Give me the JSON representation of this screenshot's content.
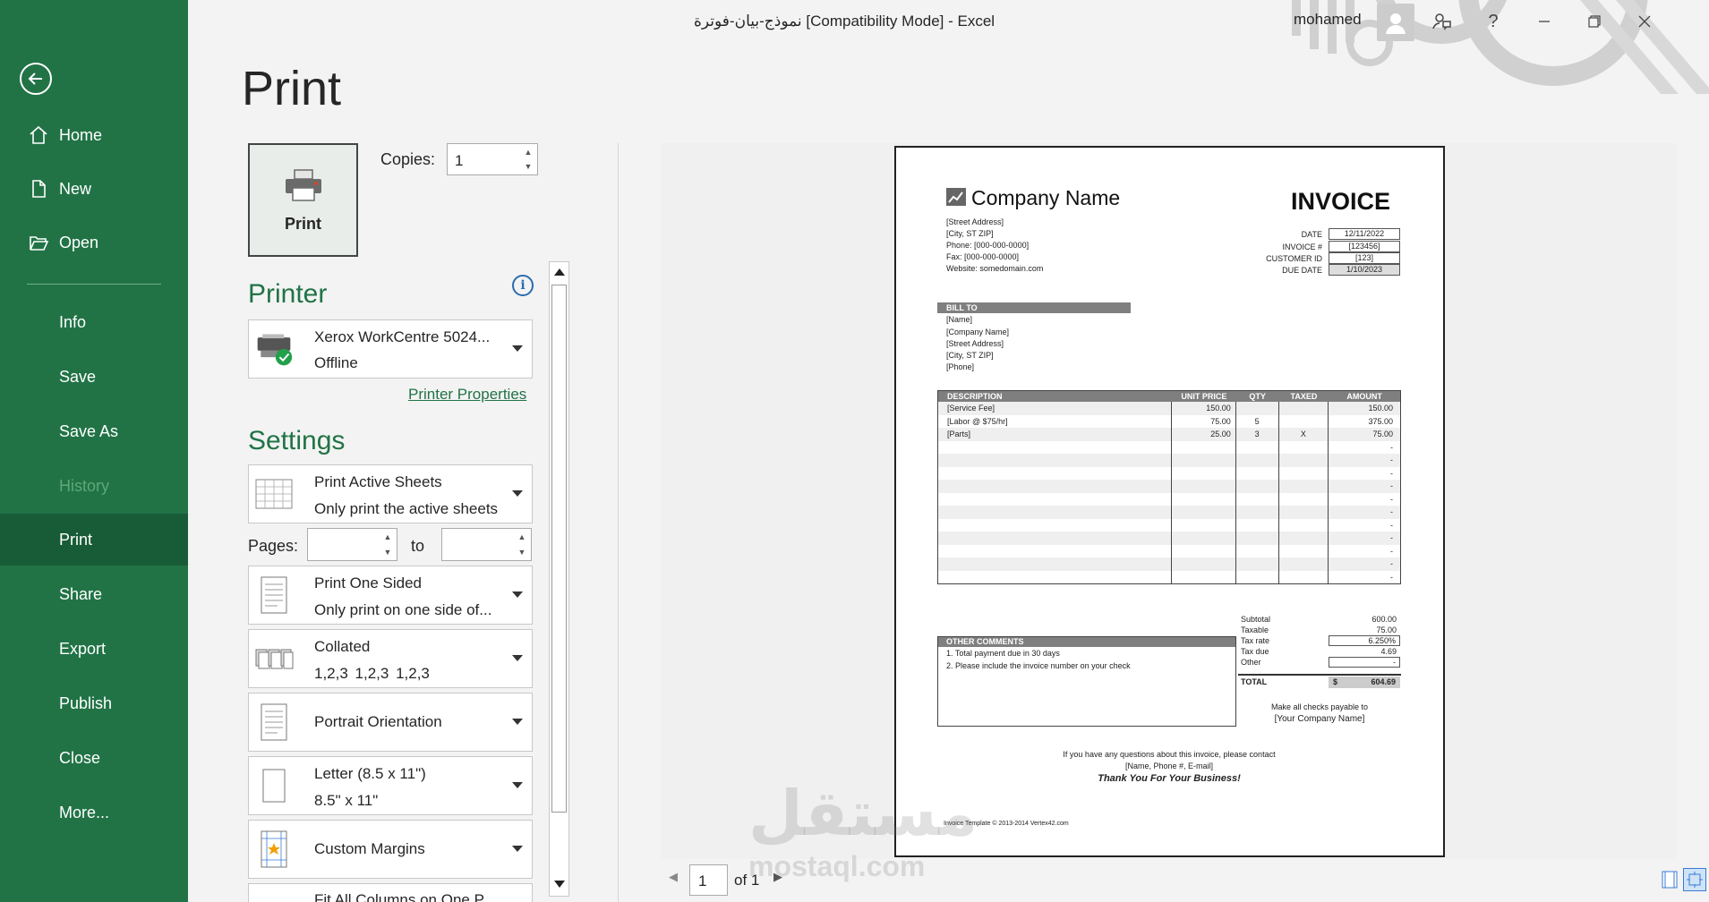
{
  "window": {
    "title": "نموذج-بيان-فوترة  [Compatibility Mode]  -  Excel",
    "user": "mohamed"
  },
  "sidebar": {
    "items": [
      {
        "label": "Home",
        "icon": "home-icon"
      },
      {
        "label": "New",
        "icon": "new-document-icon"
      },
      {
        "label": "Open",
        "icon": "open-folder-icon"
      },
      {
        "label": "Info"
      },
      {
        "label": "Save"
      },
      {
        "label": "Save As"
      },
      {
        "label": "History"
      },
      {
        "label": "Print"
      },
      {
        "label": "Share"
      },
      {
        "label": "Export"
      },
      {
        "label": "Publish"
      },
      {
        "label": "Close"
      },
      {
        "label": "More..."
      }
    ]
  },
  "print": {
    "title": "Print",
    "button_label": "Print",
    "copies_label": "Copies:",
    "copies_value": "1",
    "printer_heading": "Printer",
    "printer_name": "Xerox WorkCentre 5024...",
    "printer_status": "Offline",
    "printer_properties": "Printer Properties",
    "settings_heading": "Settings",
    "pages_label": "Pages:",
    "to_label": "to",
    "settings": [
      {
        "line1": "Print Active Sheets",
        "line2": "Only print the active sheets"
      },
      {
        "line1": "Print One Sided",
        "line2": "Only print on one side of..."
      },
      {
        "line1": "Collated",
        "line2": "1,2,3    1,2,3    1,2,3"
      },
      {
        "line1": "Portrait Orientation"
      },
      {
        "line1": "Letter (8.5 x 11\")",
        "line2": "8.5\" x 11\""
      },
      {
        "line1": "Custom Margins"
      },
      {
        "line1": "Fit All Columns on One P..."
      }
    ]
  },
  "preview": {
    "page_number": "1",
    "page_of": "of 1",
    "watermark": "مستقل",
    "watermark_url": "mostaql.com"
  },
  "invoice": {
    "company": "Company Name",
    "title": "INVOICE",
    "address": [
      "[Street Address]",
      "[City, ST  ZIP]",
      "Phone: [000-000-0000]",
      "Fax: [000-000-0000]",
      "Website: somedomain.com"
    ],
    "meta": [
      {
        "label": "DATE",
        "value": "12/11/2022"
      },
      {
        "label": "INVOICE #",
        "value": "[123456]"
      },
      {
        "label": "CUSTOMER ID",
        "value": "[123]"
      },
      {
        "label": "DUE DATE",
        "value": "1/10/2023"
      }
    ],
    "bill_to_label": "BILL TO",
    "bill_to": [
      "[Name]",
      "[Company Name]",
      "[Street Address]",
      "[City, ST  ZIP]",
      "[Phone]"
    ],
    "columns": [
      "DESCRIPTION",
      "UNIT PRICE",
      "QTY",
      "TAXED",
      "AMOUNT"
    ],
    "rows": [
      [
        "[Service Fee]",
        "150.00",
        "",
        "",
        "150.00"
      ],
      [
        "[Labor @ $75/hr]",
        "75.00",
        "5",
        "",
        "375.00"
      ],
      [
        "[Parts]",
        "25.00",
        "3",
        "X",
        "75.00"
      ],
      [
        "",
        "",
        "",
        "",
        "-"
      ],
      [
        "",
        "",
        "",
        "",
        "-"
      ],
      [
        "",
        "",
        "",
        "",
        "-"
      ],
      [
        "",
        "",
        "",
        "",
        "-"
      ],
      [
        "",
        "",
        "",
        "",
        "-"
      ],
      [
        "",
        "",
        "",
        "",
        "-"
      ],
      [
        "",
        "",
        "",
        "",
        "-"
      ],
      [
        "",
        "",
        "",
        "",
        "-"
      ],
      [
        "",
        "",
        "",
        "",
        "-"
      ],
      [
        "",
        "",
        "",
        "",
        "-"
      ],
      [
        "",
        "",
        "",
        "",
        "-"
      ]
    ],
    "comments_label": "OTHER COMMENTS",
    "comments": [
      "1. Total payment due in 30 days",
      "2. Please include the invoice number on your check"
    ],
    "totals": [
      {
        "label": "Subtotal",
        "value": "600.00"
      },
      {
        "label": "Taxable",
        "value": "75.00"
      },
      {
        "label": "Tax rate",
        "value": "6.250%"
      },
      {
        "label": "Tax due",
        "value": "4.69"
      },
      {
        "label": "Other",
        "value": "-"
      }
    ],
    "total_label": "TOTAL",
    "total_currency": "$",
    "total_value": "604.69",
    "payable_line1": "Make all checks payable to",
    "payable_line2": "[Your Company Name]",
    "contact_line1": "If you have any questions about this invoice, please contact",
    "contact_line2": "[Name, Phone #, E-mail]",
    "thanks": "Thank You For Your Business!",
    "footer": "Invoice Template © 2013-2014 Vertex42.com"
  }
}
